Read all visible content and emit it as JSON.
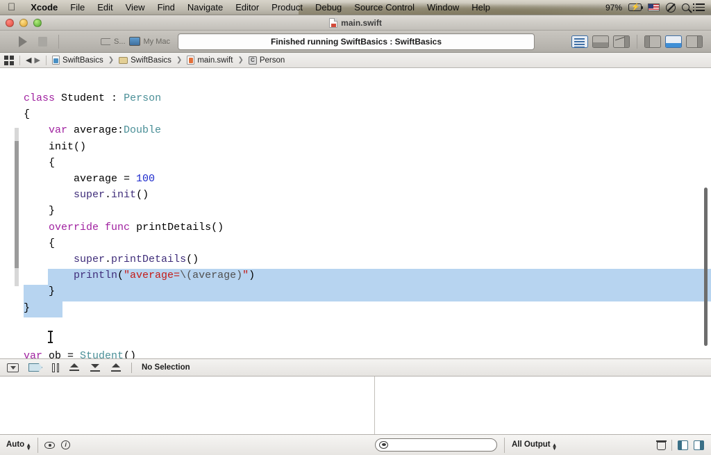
{
  "menubar": {
    "apple": "",
    "items": [
      {
        "label": "Xcode",
        "bold": true
      },
      {
        "label": "File",
        "bold": false
      },
      {
        "label": "Edit",
        "bold": false
      },
      {
        "label": "View",
        "bold": false
      },
      {
        "label": "Find",
        "bold": false
      },
      {
        "label": "Navigate",
        "bold": false
      },
      {
        "label": "Editor",
        "bold": false
      },
      {
        "label": "Product",
        "bold": false
      },
      {
        "label": "Debug",
        "bold": false
      },
      {
        "label": "Source Control",
        "bold": false
      },
      {
        "label": "Window",
        "bold": false
      },
      {
        "label": "Help",
        "bold": false
      }
    ],
    "battery_percent": "97%",
    "status_icons": [
      "battery-icon",
      "input-flag-icon",
      "do-not-disturb-icon",
      "spotlight-search-icon",
      "notification-center-icon"
    ]
  },
  "titlebar": {
    "document_title": "main.swift",
    "window_controls": [
      "close",
      "minimize",
      "zoom"
    ]
  },
  "toolbar": {
    "run_label": "Run",
    "stop_label": "Stop",
    "scheme_name": "S...",
    "destination": "My Mac",
    "activity_status": "Finished running SwiftBasics : SwiftBasics",
    "view_buttons": [
      {
        "name": "navigator-toggle",
        "selected": true
      },
      {
        "name": "debug-area-toggle",
        "selected": false
      },
      {
        "name": "utilities-toggle",
        "selected": false
      },
      {
        "name": "standard-editor",
        "selected": false
      },
      {
        "name": "assistant-editor",
        "selected": true
      },
      {
        "name": "version-editor",
        "selected": false
      }
    ]
  },
  "jumpbar": {
    "back_label": "◀",
    "forward_label": "▶",
    "crumbs": [
      {
        "label": "SwiftBasics",
        "icon": "project-icon"
      },
      {
        "label": "SwiftBasics",
        "icon": "folder-icon"
      },
      {
        "label": "main.swift",
        "icon": "swift-file-icon"
      },
      {
        "label": "Person",
        "icon": "class-icon"
      }
    ]
  },
  "editor": {
    "language": "swift",
    "code_lines": [
      {
        "indent": 0,
        "tokens": [
          {
            "t": "class",
            "c": "k"
          },
          {
            "t": " ",
            "c": "nm"
          },
          {
            "t": "Student",
            "c": "nm"
          },
          {
            "t": " : ",
            "c": "nm"
          },
          {
            "t": "Person",
            "c": "ty"
          }
        ]
      },
      {
        "indent": 0,
        "tokens": [
          {
            "t": "{",
            "c": "nm"
          }
        ]
      },
      {
        "indent": 1,
        "tokens": [
          {
            "t": "var",
            "c": "k"
          },
          {
            "t": " average:",
            "c": "nm"
          },
          {
            "t": "Double",
            "c": "ty"
          }
        ]
      },
      {
        "indent": 1,
        "tokens": [
          {
            "t": "init()",
            "c": "nm"
          }
        ]
      },
      {
        "indent": 1,
        "tokens": [
          {
            "t": "{",
            "c": "nm"
          }
        ]
      },
      {
        "indent": 2,
        "tokens": [
          {
            "t": "average = ",
            "c": "nm"
          },
          {
            "t": "100",
            "c": "num"
          }
        ]
      },
      {
        "indent": 2,
        "tokens": [
          {
            "t": "super",
            "c": "fn"
          },
          {
            "t": ".",
            "c": "nm"
          },
          {
            "t": "init",
            "c": "fn"
          },
          {
            "t": "()",
            "c": "nm"
          }
        ]
      },
      {
        "indent": 1,
        "tokens": [
          {
            "t": "}",
            "c": "nm"
          }
        ]
      },
      {
        "indent": 1,
        "tokens": [
          {
            "t": "override",
            "c": "k"
          },
          {
            "t": " ",
            "c": "nm"
          },
          {
            "t": "func",
            "c": "k"
          },
          {
            "t": " printDetails()",
            "c": "nm"
          }
        ]
      },
      {
        "indent": 1,
        "tokens": [
          {
            "t": "{",
            "c": "nm"
          }
        ]
      },
      {
        "indent": 2,
        "tokens": [
          {
            "t": "super",
            "c": "fn"
          },
          {
            "t": ".",
            "c": "nm"
          },
          {
            "t": "printDetails",
            "c": "fn"
          },
          {
            "t": "()",
            "c": "nm"
          }
        ]
      },
      {
        "indent": 2,
        "tokens": [
          {
            "t": "println",
            "c": "fn"
          },
          {
            "t": "(",
            "c": "nm"
          },
          {
            "t": "\"average=",
            "c": "str"
          },
          {
            "t": "\\(average)",
            "c": "interp"
          },
          {
            "t": "\"",
            "c": "str"
          },
          {
            "t": ")",
            "c": "nm"
          }
        ]
      },
      {
        "indent": 1,
        "tokens": [
          {
            "t": "}",
            "c": "nm"
          }
        ]
      },
      {
        "indent": 0,
        "tokens": [
          {
            "t": "}",
            "c": "nm"
          }
        ]
      },
      {
        "indent": 0,
        "tokens": []
      },
      {
        "indent": 0,
        "tokens": []
      },
      {
        "indent": 0,
        "tokens": [
          {
            "t": "var",
            "c": "k"
          },
          {
            "t": " ob = ",
            "c": "nm"
          },
          {
            "t": "Student",
            "c": "ty"
          },
          {
            "t": "()",
            "c": "nm"
          }
        ]
      }
    ],
    "selection": {
      "from_line": 11,
      "to_line": 13,
      "color": "#b7d4f0"
    },
    "colors": {
      "keyword": "#a021a0",
      "type": "#4a8f97",
      "number": "#1c29cc",
      "function": "#3f2d7a",
      "string": "#c41a16",
      "plain": "#000000",
      "selection": "#b7d4f0"
    }
  },
  "debugbar": {
    "buttons": [
      {
        "name": "hide-debug-area-button",
        "label": "Hide Debug Area"
      },
      {
        "name": "breakpoints-toggle-button",
        "label": "Breakpoints"
      },
      {
        "name": "pause-continue-button",
        "label": "Continue"
      },
      {
        "name": "step-over-button",
        "label": "Step Over"
      },
      {
        "name": "step-into-button",
        "label": "Step Into"
      },
      {
        "name": "step-out-button",
        "label": "Step Out"
      }
    ],
    "status": "No Selection"
  },
  "bottombar": {
    "scope_label": "Auto",
    "eye_label": "Quick Look",
    "info_label": "Info",
    "filter_placeholder": "",
    "output_label": "All Output",
    "clear_label": "Clear Console",
    "split_left_label": "Show Variables View",
    "split_right_label": "Show Console"
  }
}
